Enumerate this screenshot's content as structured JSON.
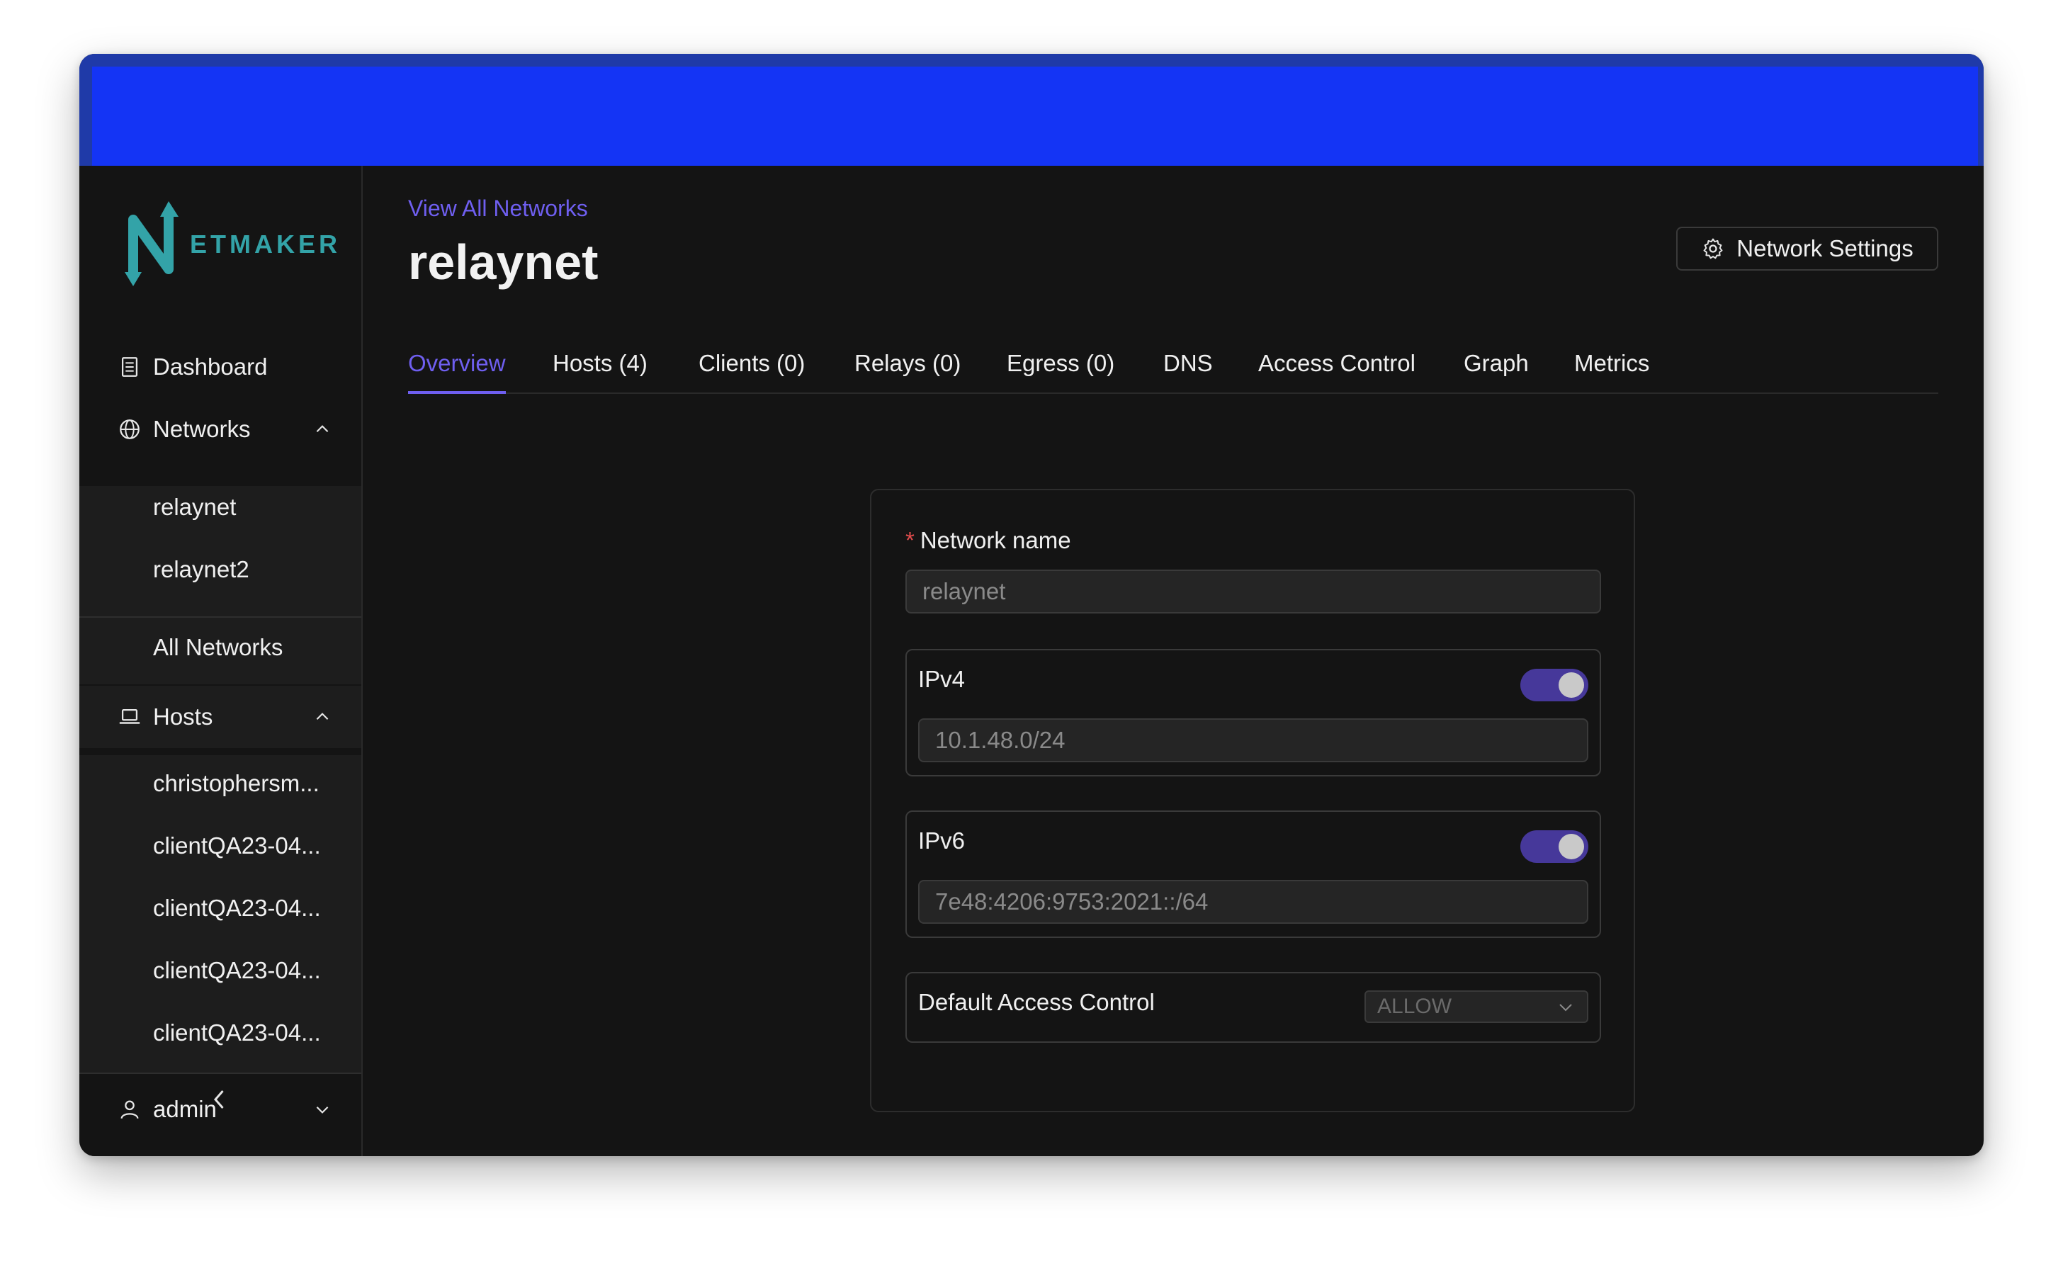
{
  "app": {
    "logo_text": "ETMAKER"
  },
  "sidebar": {
    "dashboard": "Dashboard",
    "networks": "Networks",
    "networks_items": [
      "relaynet",
      "relaynet2"
    ],
    "all_networks": "All Networks",
    "hosts": "Hosts",
    "hosts_items": [
      "christophersm...",
      "clientQA23-04...",
      "clientQA23-04...",
      "clientQA23-04...",
      "clientQA23-04..."
    ],
    "user": "admin"
  },
  "header": {
    "view_all": "View All Networks",
    "title": "relaynet",
    "settings_button": "Network Settings"
  },
  "tabs": [
    "Overview",
    "Hosts (4)",
    "Clients (0)",
    "Relays (0)",
    "Egress (0)",
    "DNS",
    "Access Control",
    "Graph",
    "Metrics"
  ],
  "active_tab": "Overview",
  "form": {
    "network_name_label": "Network name",
    "network_name_required": "*",
    "network_name_value": "relaynet",
    "ipv4_label": "IPv4",
    "ipv4_enabled": true,
    "ipv4_value": "10.1.48.0/24",
    "ipv6_label": "IPv6",
    "ipv6_enabled": true,
    "ipv6_value": "7e48:4206:9753:2021::/64",
    "default_acl_label": "Default Access Control",
    "default_acl_value": "ALLOW"
  },
  "colors": {
    "accent": "#6f5ff0",
    "banner": "#1434f5",
    "logo": "#33a3a8",
    "background": "#141414"
  }
}
